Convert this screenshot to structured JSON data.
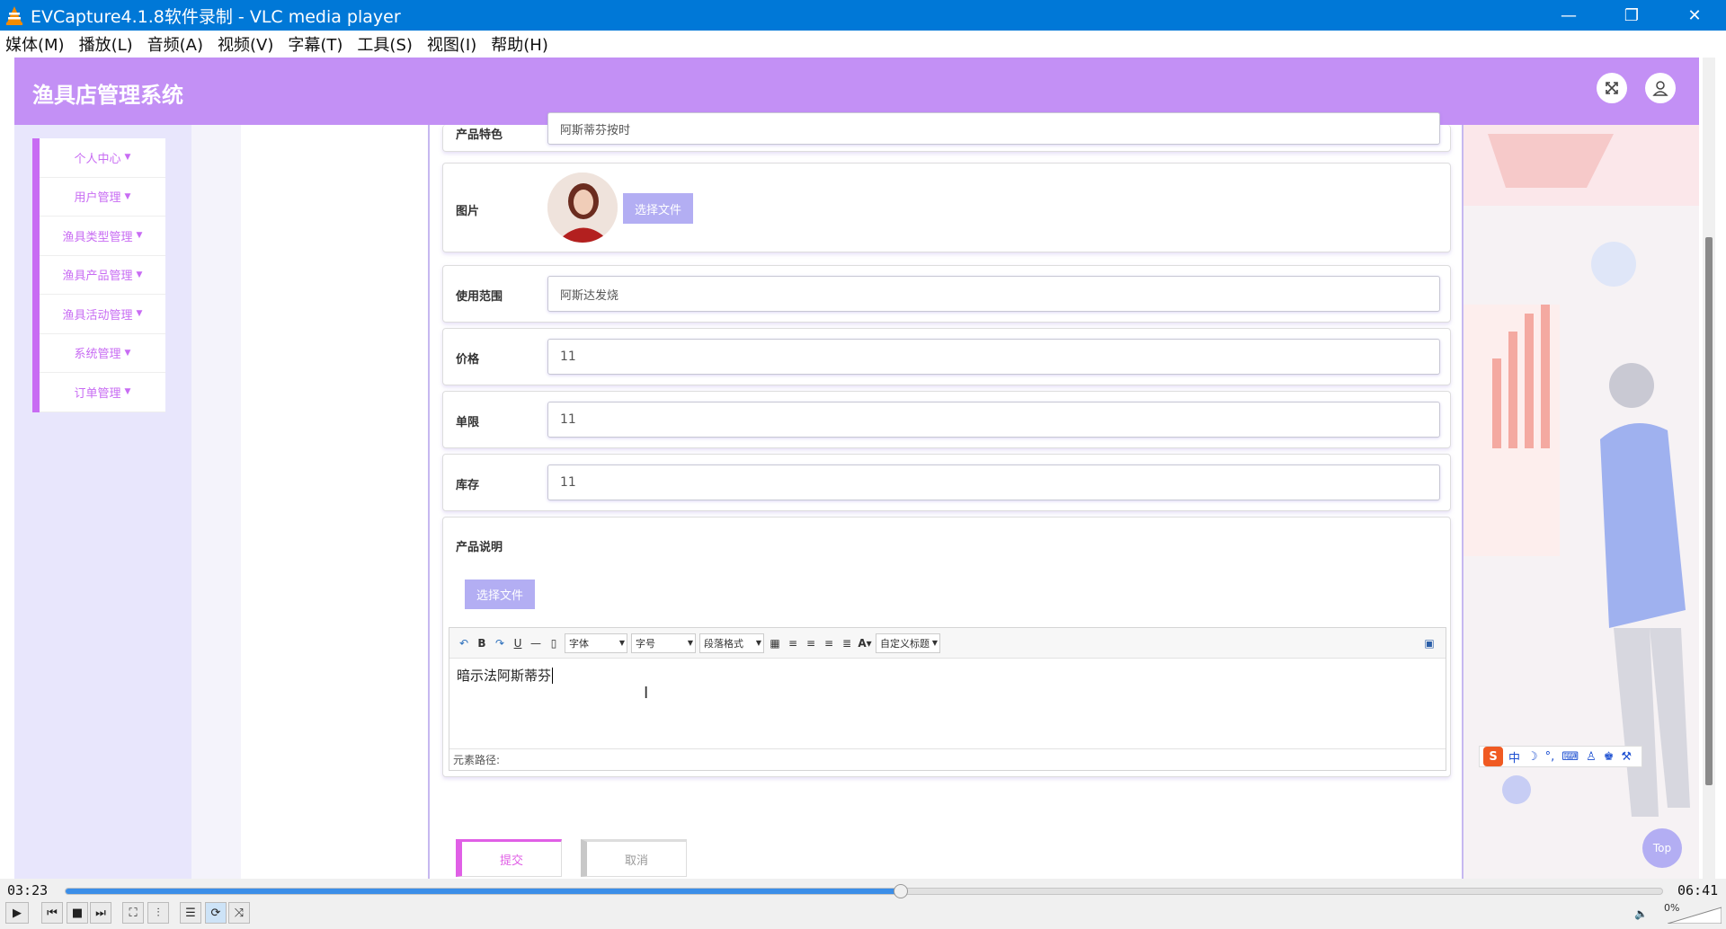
{
  "window": {
    "title": "EVCapture4.1.8软件录制 - VLC media player",
    "controls": {
      "minimize": "—",
      "restore": "❐",
      "close": "✕"
    }
  },
  "menubar": [
    "媒体(M)",
    "播放(L)",
    "音频(A)",
    "视频(V)",
    "字幕(T)",
    "工具(S)",
    "视图(I)",
    "帮助(H)"
  ],
  "app": {
    "title": "渔具店管理系统",
    "sidebar": [
      {
        "label": "个人中心"
      },
      {
        "label": "用户管理"
      },
      {
        "label": "渔具类型管理"
      },
      {
        "label": "渔具产品管理"
      },
      {
        "label": "渔具活动管理"
      },
      {
        "label": "系统管理"
      },
      {
        "label": "订单管理"
      }
    ]
  },
  "form": {
    "feature": {
      "label": "产品特色",
      "value": "阿斯蒂芬按时"
    },
    "image": {
      "label": "图片",
      "button": "选择文件"
    },
    "scope": {
      "label": "使用范围",
      "value": "阿斯达发烧"
    },
    "price": {
      "label": "价格",
      "value": "11"
    },
    "limit": {
      "label": "单限",
      "value": "11"
    },
    "stock": {
      "label": "库存",
      "value": "11"
    },
    "description": {
      "label": "产品说明",
      "button": "选择文件",
      "toolbar": {
        "font": "字体",
        "size": "字号",
        "paragraph": "段落格式",
        "custom_title": "自定义标题"
      },
      "content": "暗示法阿斯蒂芬",
      "footer": "元素路径:"
    },
    "submit": "提交",
    "cancel": "取消"
  },
  "top_button": "Top",
  "ime": {
    "logo": "S",
    "mode": "中"
  },
  "player": {
    "elapsed": "03:23",
    "total": "06:41",
    "progress": 0.523,
    "volume": "0%"
  }
}
